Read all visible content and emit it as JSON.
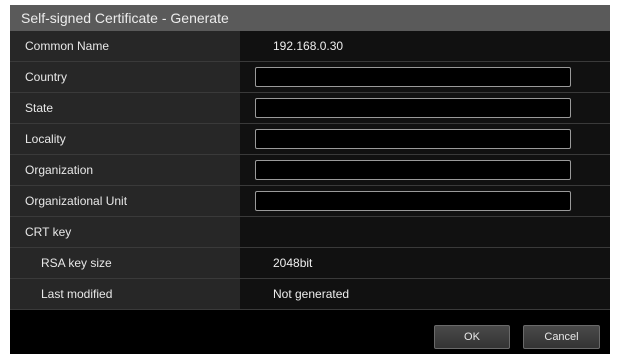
{
  "dialog": {
    "title": "Self-signed Certificate - Generate"
  },
  "rows": {
    "common_name": {
      "label": "Common Name",
      "value": "192.168.0.30"
    },
    "country": {
      "label": "Country",
      "value": ""
    },
    "state": {
      "label": "State",
      "value": ""
    },
    "locality": {
      "label": "Locality",
      "value": ""
    },
    "organization": {
      "label": "Organization",
      "value": ""
    },
    "organizational_unit": {
      "label": "Organizational Unit",
      "value": ""
    },
    "crt_key": {
      "label": "CRT key"
    },
    "rsa_key_size": {
      "label": "RSA key size",
      "value": "2048bit"
    },
    "last_modified": {
      "label": "Last modified",
      "value": "Not generated"
    }
  },
  "buttons": {
    "ok": "OK",
    "cancel": "Cancel"
  }
}
